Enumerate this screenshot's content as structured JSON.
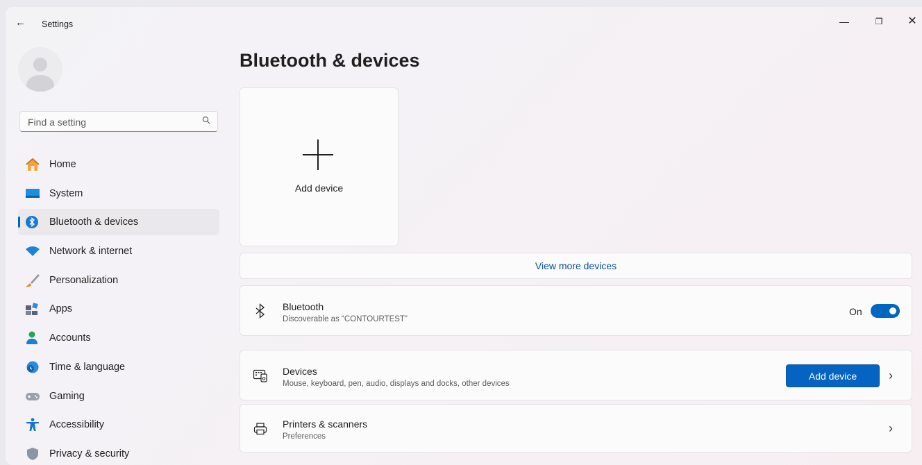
{
  "window": {
    "title": "Settings",
    "back_icon": "←",
    "minimize_icon": "—",
    "maximize_icon": "❐",
    "close_icon": "✕"
  },
  "search": {
    "placeholder": "Find a setting",
    "icon": "search-icon"
  },
  "sidebar": {
    "items": [
      {
        "label": "Home",
        "icon": "home-icon"
      },
      {
        "label": "System",
        "icon": "monitor-icon"
      },
      {
        "label": "Bluetooth & devices",
        "icon": "bluetooth-icon",
        "selected": true
      },
      {
        "label": "Network & internet",
        "icon": "wifi-icon"
      },
      {
        "label": "Personalization",
        "icon": "brush-icon"
      },
      {
        "label": "Apps",
        "icon": "apps-icon"
      },
      {
        "label": "Accounts",
        "icon": "person-icon"
      },
      {
        "label": "Time & language",
        "icon": "globe-clock-icon"
      },
      {
        "label": "Gaming",
        "icon": "gamepad-icon"
      },
      {
        "label": "Accessibility",
        "icon": "accessibility-icon"
      },
      {
        "label": "Privacy & security",
        "icon": "shield-icon"
      }
    ]
  },
  "main": {
    "title": "Bluetooth & devices",
    "add_tile_label": "Add device",
    "view_more_label": "View more devices",
    "bluetooth": {
      "title": "Bluetooth",
      "subtitle": "Discoverable as “CONTOURTEST”",
      "toggle_label": "On",
      "toggle_on": true
    },
    "devices": {
      "title": "Devices",
      "subtitle": "Mouse, keyboard, pen, audio, displays and docks, other devices",
      "button_label": "Add device",
      "chevron": "›"
    },
    "printers": {
      "title": "Printers & scanners",
      "subtitle": "Preferences",
      "chevron": "›"
    }
  },
  "colors": {
    "accent": "#0067c0",
    "link": "#0a4f9c"
  }
}
